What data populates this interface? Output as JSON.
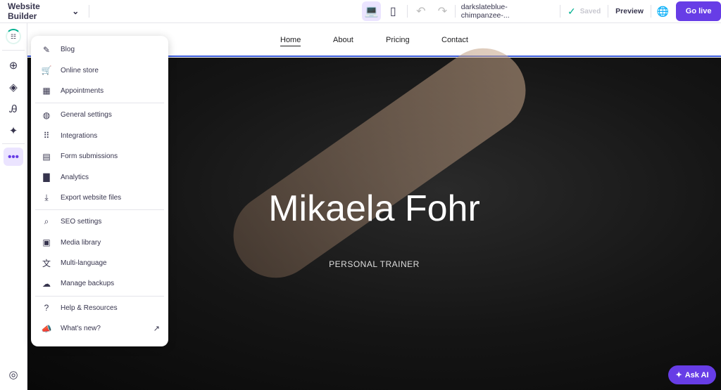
{
  "header": {
    "app_title": "Website Builder",
    "domain": "darkslateblue-chimpanzee-...",
    "saved": "Saved",
    "preview": "Preview",
    "go_live": "Go live"
  },
  "nav": {
    "items": [
      "Home",
      "About",
      "Pricing",
      "Contact"
    ]
  },
  "hero": {
    "title": "Mikaela Fohr",
    "subtitle": "PERSONAL TRAINER"
  },
  "menu": {
    "items": [
      "Blog",
      "Online store",
      "Appointments",
      "General settings",
      "Integrations",
      "Form submissions",
      "Analytics",
      "Export website files",
      "SEO settings",
      "Media library",
      "Multi-language",
      "Manage backups",
      "Help & Resources",
      "What's new?"
    ]
  },
  "ask_ai": "Ask AI",
  "colors": {
    "accent": "#673de6",
    "saved": "#00b090"
  }
}
